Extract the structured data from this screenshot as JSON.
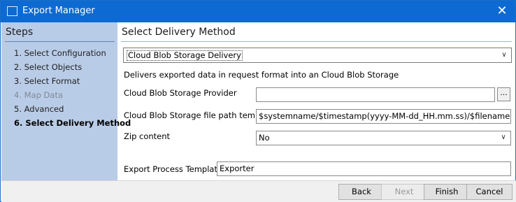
{
  "window": {
    "title": "Export Manager",
    "close_symbol": "✕"
  },
  "steps": {
    "header": "Steps",
    "items": [
      {
        "label": "1. Select Configuration",
        "state": "normal"
      },
      {
        "label": "2. Select Objects",
        "state": "normal"
      },
      {
        "label": "3. Select Format",
        "state": "normal"
      },
      {
        "label": "4. Map Data",
        "state": "disabled"
      },
      {
        "label": "5. Advanced",
        "state": "normal"
      },
      {
        "label": "6. Select Delivery Method",
        "state": "current"
      }
    ]
  },
  "main": {
    "title": "Select Delivery Method",
    "delivery_method": "Cloud Blob Storage Delivery",
    "description": "Delivers exported data in request format into an Cloud Blob Storage",
    "fields": {
      "provider_label": "Cloud Blob Storage Provider",
      "provider_value": "",
      "browse_label": "...",
      "path_label": "Cloud Blob Storage file path template",
      "path_value": "$systemname/$timestamp(yyyy-MM-dd_HH.mm.ss)/$filename.$extension",
      "zip_label": "Zip content",
      "zip_value": "No",
      "template_label": "Export Process Template:",
      "template_value": "Exporter"
    }
  },
  "footer": {
    "back": "Back",
    "next": "Next",
    "finish": "Finish",
    "cancel": "Cancel"
  },
  "colors": {
    "titlebar": "#0d6ad3",
    "steps_panel": "#b9cce7"
  }
}
